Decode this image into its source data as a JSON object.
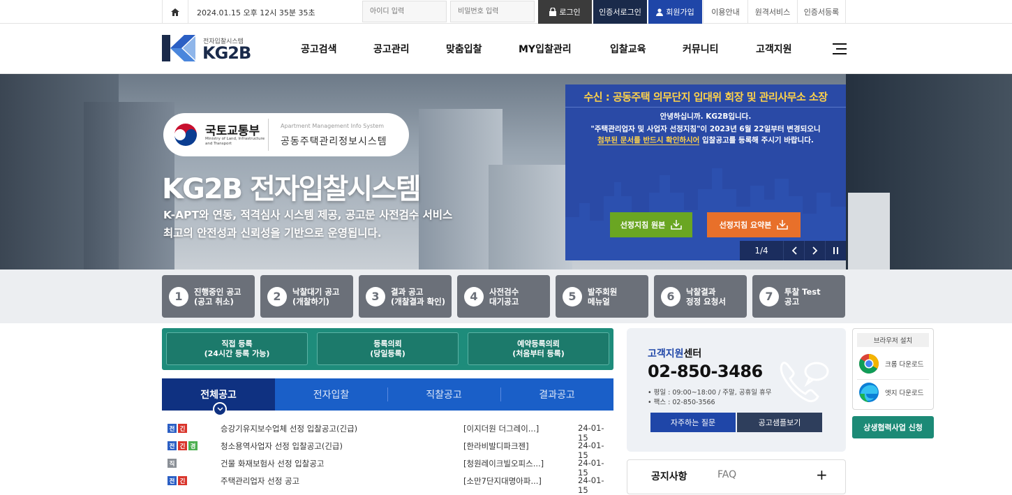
{
  "topbar": {
    "datetime": "2024.01.15  오후 12시 35분 35초",
    "id_placeholder": "아이디 입력",
    "pw_placeholder": "비밀번호 입력",
    "login": "로그인",
    "cert_login": "인증서로그인",
    "join": "회원가입",
    "links": [
      "이용안내",
      "원격서비스",
      "인증서등록"
    ]
  },
  "header": {
    "logo_small": "전자입찰시스템",
    "logo_big": "KG2B",
    "nav": [
      "공고검색",
      "공고관리",
      "맞춤입찰",
      "MY입찰관리",
      "입찰교육",
      "커뮤니티",
      "고객지원"
    ]
  },
  "hero": {
    "ministry": "국토교통부",
    "ministry_en": "Ministry of Land, Infrastructure and Transport",
    "system_en": "Apartment Management Info System",
    "system_ko": "공동주택관리정보시스템",
    "title": "KG2B 전자입찰시스템",
    "sub1": "K-APT와 연동, 적격심사 시스템 제공, 공고문 사전검수 서비스",
    "sub2": "최고의 안전성과 신뢰성을 기반으로 운영됩니다."
  },
  "notice_popup": {
    "title": "수신 : 공동주택 의무단지 입대위 회장 및 관리사무소 소장",
    "line1": "안녕하십니까. KG2B입니다.",
    "line2": "\"주택관리업자 및 사업자 선정지침\"이 2023년 6월 22일부터 변경되오니",
    "line3_highlight": "첨부된 문서를 반드시 확인하시어",
    "line3_rest": " 입찰공고를 등록해 주시기 바랍니다.",
    "btn_original": "선정지침 원본",
    "btn_summary": "선정지침 요약본",
    "pager": "1/4",
    "colors": {
      "green": "#6aa622",
      "orange": "#e8702a"
    }
  },
  "quick": [
    {
      "num": "1",
      "label1": "진행중인 공고",
      "label2": "(공고 취소)"
    },
    {
      "num": "2",
      "label1": "낙찰대기 공고",
      "label2": "(개찰하기)"
    },
    {
      "num": "3",
      "label1": "결과 공고",
      "label2": "(개찰결과 확인)"
    },
    {
      "num": "4",
      "label1": "사전검수",
      "label2": "대기공고"
    },
    {
      "num": "5",
      "label1": "발주회원",
      "label2": "메뉴얼"
    },
    {
      "num": "6",
      "label1": "낙찰결과",
      "label2": "정정 요청서"
    },
    {
      "num": "7",
      "label1": "투찰 Test",
      "label2": "공고"
    }
  ],
  "register": [
    {
      "l1": "직접 등록",
      "l2": "(24시간 등록 가능)"
    },
    {
      "l1": "등록의뢰",
      "l2": "(당일등록)"
    },
    {
      "l1": "예약등록의뢰",
      "l2": "(처음부터 등록)"
    }
  ],
  "tabs": [
    "전체공고",
    "전자입찰",
    "직찰공고",
    "결과공고"
  ],
  "list": [
    {
      "tags": [
        "전",
        "긴"
      ],
      "title": "승강기유지보수업체 선정 입찰공고(긴급)",
      "org": "[이지더원 더그레이...]",
      "date": "24-01-15"
    },
    {
      "tags": [
        "전",
        "긴",
        "경"
      ],
      "title": "청소용역사업자 선정 입찰공고(긴급)",
      "org": "[한라비발디파크젠]",
      "date": "24-01-15"
    },
    {
      "tags": [
        "직"
      ],
      "title": "건물 화재보험사 선정 입찰공고",
      "org": "[청원레이크빌오피스...]",
      "date": "24-01-15"
    },
    {
      "tags": [
        "전",
        "긴"
      ],
      "title": "주택관리업자 선정 공고",
      "org": "[소만7단지대명아파...]",
      "date": "24-01-15"
    }
  ],
  "customer": {
    "title_bold": "고객지원",
    "title_rest": "센터",
    "phone": "02-850-3486",
    "hours": "• 평일 : 09:00~18:00 / 주말, 공휴일 휴무",
    "fax": "• 팩스 : 02-850-3566",
    "faq_btn": "자주하는 질문",
    "sample_btn": "공고샘플보기"
  },
  "notice_tabs": {
    "notice": "공지사항",
    "faq": "FAQ",
    "plus": "+"
  },
  "browser": {
    "title": "브라우저 설치",
    "chrome": "크롬 다운로드",
    "edge": "엣지 다운로드"
  },
  "green_btn": "상생협력사업 신청"
}
